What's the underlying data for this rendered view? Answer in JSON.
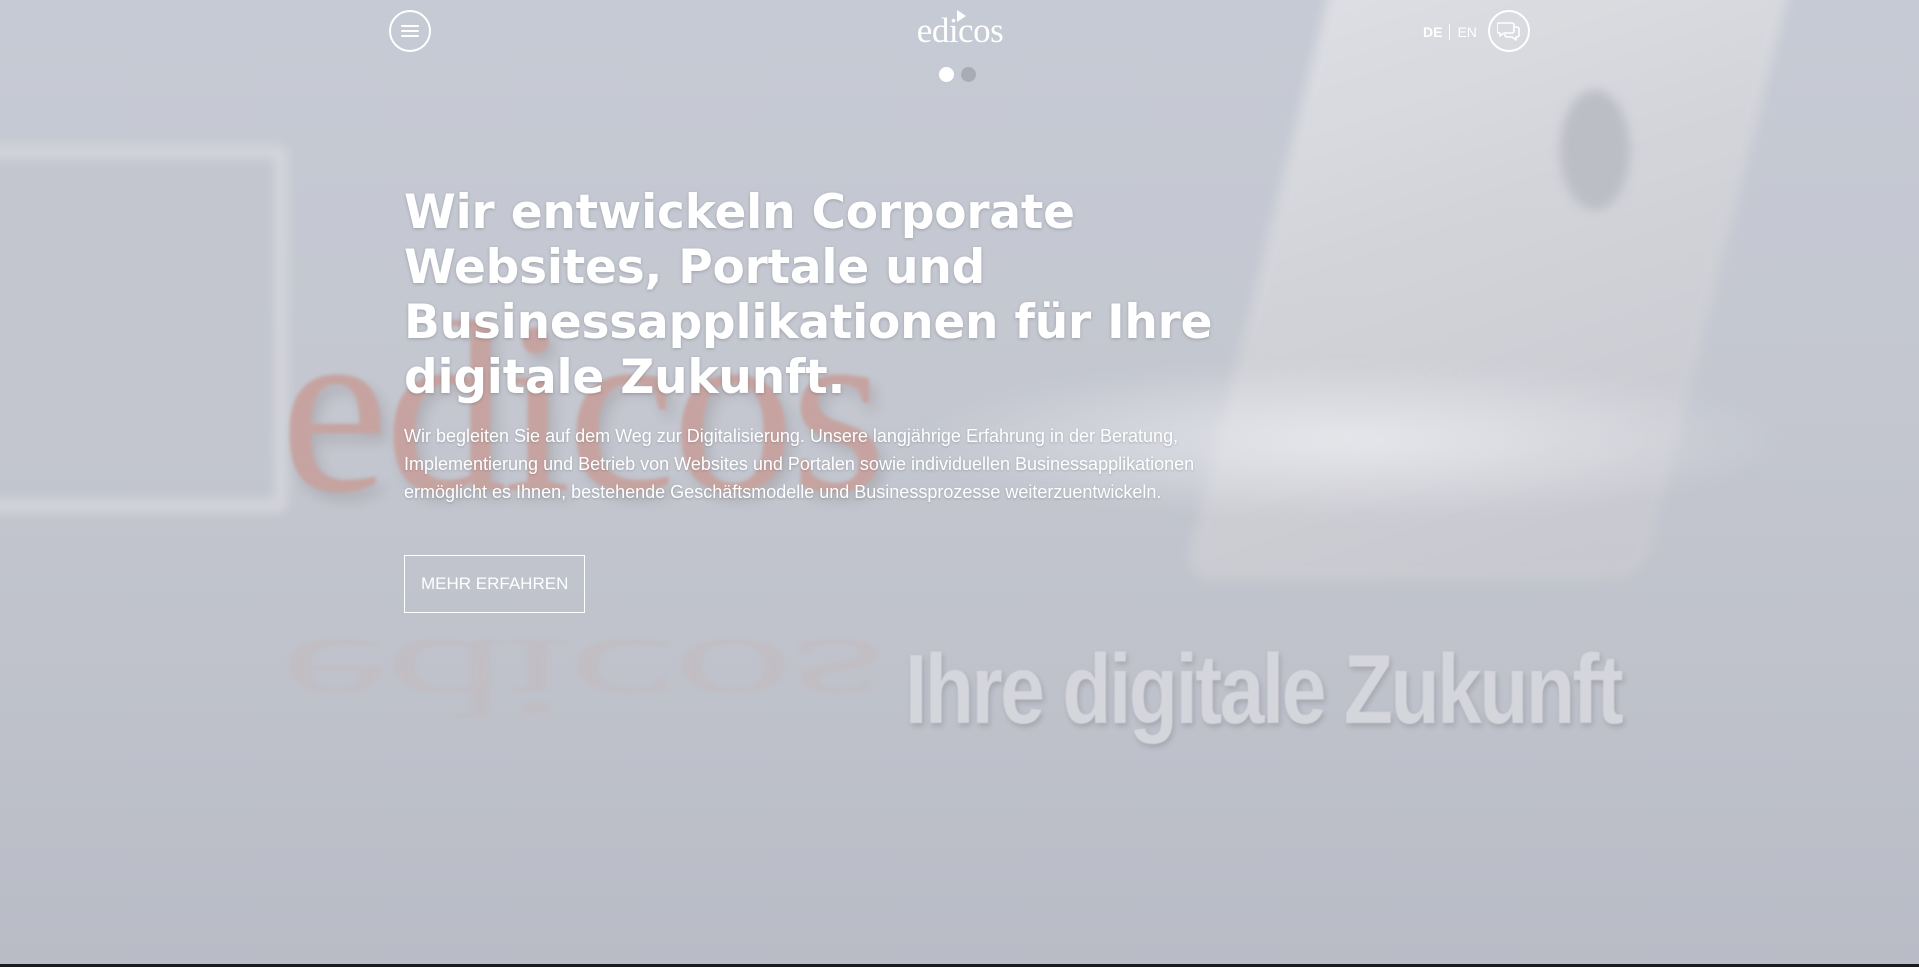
{
  "header": {
    "brand": "edicos",
    "languages": {
      "active": "DE",
      "other": "EN"
    }
  },
  "slider": {
    "slides": 2,
    "active_index": 1
  },
  "hero": {
    "title": "Wir entwickeln Corporate Websites, Portale und Businessapplikationen für Ihre digitale Zukunft.",
    "text": "Wir begleiten Sie auf dem Weg zur Digitalisierung. Unsere langjährige Erfahrung in der Beratung, Implementierung und Betrieb von Websites und Portalen sowie individuellen Businessapplikationen ermöglicht es Ihnen, bestehende Geschäftsmodelle und Businessprozesse weiterzuentwickeln.",
    "cta_label": "MEHR ERFAHREN"
  },
  "background": {
    "logo_word": "edicos",
    "tagline": "Ihre digitale Zukunft"
  },
  "colors": {
    "text": "#ffffff",
    "background": "#c4c7d0",
    "logo_accent": "#c79a93"
  },
  "icons": [
    "hamburger-menu-icon",
    "chat-bubbles-icon"
  ]
}
